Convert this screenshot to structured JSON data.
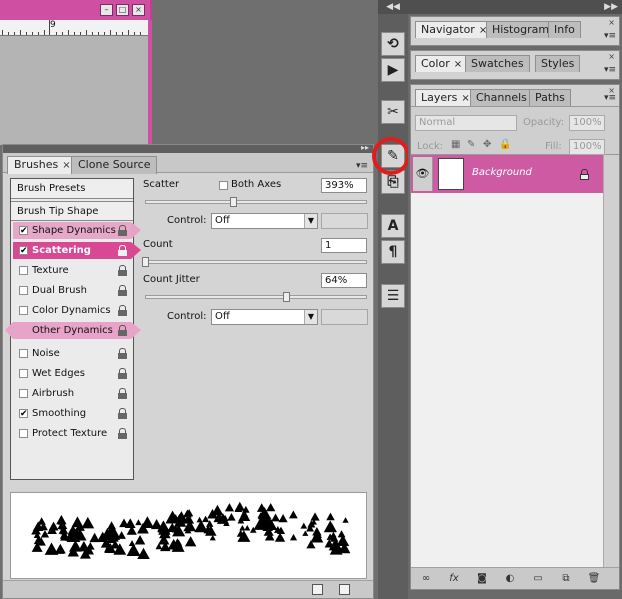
{
  "document": {
    "ruler_label": "9",
    "window_buttons": [
      "–",
      "□",
      "×"
    ]
  },
  "dock": {
    "collapse_left": "◀◀",
    "collapse_right": "▶▶",
    "panel_menu": "▸▸"
  },
  "brushes_panel": {
    "tabs": [
      {
        "label": "Brushes",
        "close": "×"
      },
      {
        "label": "Clone Source",
        "close": ""
      }
    ],
    "presets_label": "Brush Presets",
    "tip_shape_label": "Brush Tip Shape",
    "items": [
      {
        "label": "Shape Dynamics",
        "checked": "✔"
      },
      {
        "label": "Scattering",
        "checked": "✔"
      },
      {
        "label": "Texture",
        "checked": ""
      },
      {
        "label": "Dual Brush",
        "checked": ""
      },
      {
        "label": "Color Dynamics",
        "checked": ""
      },
      {
        "label": "Other Dynamics",
        "checked": ""
      },
      {
        "label": "Noise",
        "checked": ""
      },
      {
        "label": "Wet Edges",
        "checked": ""
      },
      {
        "label": "Airbrush",
        "checked": ""
      },
      {
        "label": "Smoothing",
        "checked": "✔"
      },
      {
        "label": "Protect Texture",
        "checked": ""
      }
    ],
    "options": {
      "scatter_label": "Scatter",
      "both_axes_label": "Both Axes",
      "scatter_value": "393%",
      "control_label_1": "Control:",
      "control_value_1": "Off",
      "count_label": "Count",
      "count_value": "1",
      "count_jitter_label": "Count Jitter",
      "count_jitter_value": "64%",
      "control_label_2": "Control:",
      "control_value_2": "Off"
    }
  },
  "navigator_panel": {
    "tabs": [
      {
        "label": "Navigator",
        "close": "×"
      },
      {
        "label": "Histogram",
        "close": ""
      },
      {
        "label": "Info",
        "close": ""
      }
    ]
  },
  "color_panel": {
    "tabs": [
      {
        "label": "Color",
        "close": "×"
      },
      {
        "label": "Swatches",
        "close": ""
      },
      {
        "label": "Styles",
        "close": ""
      }
    ]
  },
  "layers_panel": {
    "tabs": [
      {
        "label": "Layers",
        "close": "×"
      },
      {
        "label": "Channels",
        "close": ""
      },
      {
        "label": "Paths",
        "close": ""
      }
    ],
    "blend_mode": "Normal",
    "opacity_label": "Opacity:",
    "opacity_value": "100%",
    "lock_label": "Lock:",
    "fill_label": "Fill:",
    "fill_value": "100%",
    "layer_name": "Background"
  },
  "colors": {
    "highlight_pink": "#d94892",
    "layer_selected": "#cd5aa2",
    "callout_red": "#e01d1d"
  },
  "icons": [
    "eye-icon",
    "lock-icon",
    "trash-icon",
    "new-layer-icon",
    "fx-icon",
    "link-icon",
    "mask-icon",
    "adjustment-icon",
    "folder-icon",
    "brush-panel-icon"
  ]
}
